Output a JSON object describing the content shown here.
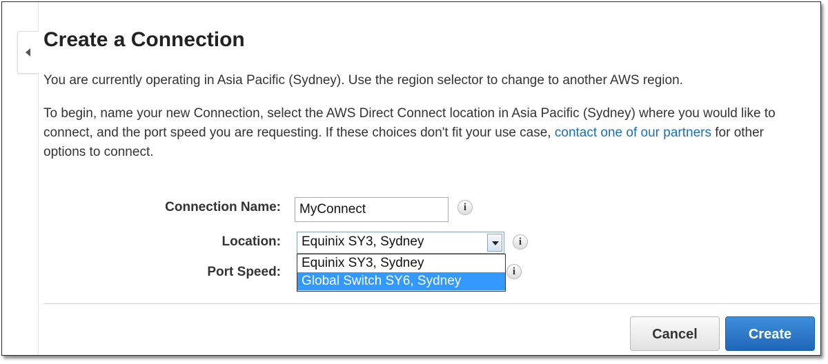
{
  "panel": {
    "title": "Create a Connection",
    "region_notice": "You are currently operating in Asia Pacific (Sydney). Use the region selector to change to another AWS region.",
    "intro_text_before_link": "To begin, name your new Connection, select the AWS Direct Connect location in Asia Pacific (Sydney) where you would like to connect, and the port speed you are requesting. If these choices don't fit your use case, ",
    "partners_link": "contact one of our partners",
    "intro_text_after_link": " for other options to connect."
  },
  "form": {
    "connection_name_label": "Connection Name:",
    "connection_name_value": "MyConnect",
    "location_label": "Location:",
    "location_value": "Equinix SY3, Sydney",
    "location_options": [
      "Equinix SY3, Sydney",
      "Global Switch SY6, Sydney"
    ],
    "highlighted_option": "Global Switch SY6, Sydney",
    "port_speed_label": "Port Speed:",
    "info_glyph": "i"
  },
  "actions": {
    "cancel_label": "Cancel",
    "create_label": "Create"
  },
  "icons": {
    "collapse": "chevron-left-icon",
    "info": "info-icon",
    "dropdown": "chevron-down-icon"
  },
  "colors": {
    "link": "#1a6fb6",
    "primary_button": "#2a78c8",
    "highlight": "#3399ff"
  }
}
